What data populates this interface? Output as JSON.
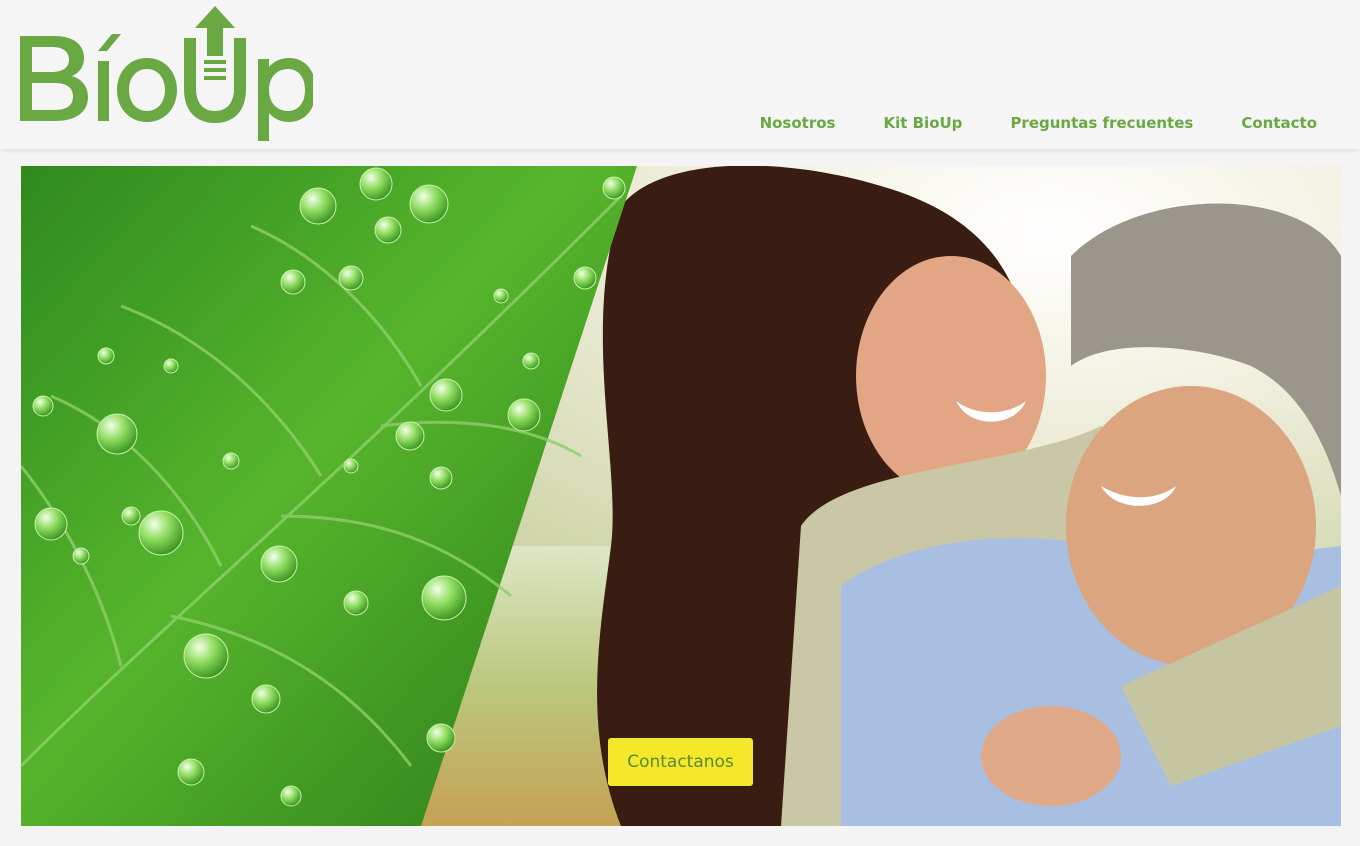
{
  "header": {
    "logo_text": "BíoUp"
  },
  "nav": {
    "items": [
      {
        "label": "Nosotros"
      },
      {
        "label": "Kit BioUp"
      },
      {
        "label": "Preguntas frecuentes"
      },
      {
        "label": "Contacto"
      }
    ]
  },
  "hero": {
    "cta_label": "Contactanos"
  },
  "colors": {
    "brand_green": "#6aa843",
    "cta_yellow": "#f5e72a",
    "background": "#f4f4f4"
  }
}
